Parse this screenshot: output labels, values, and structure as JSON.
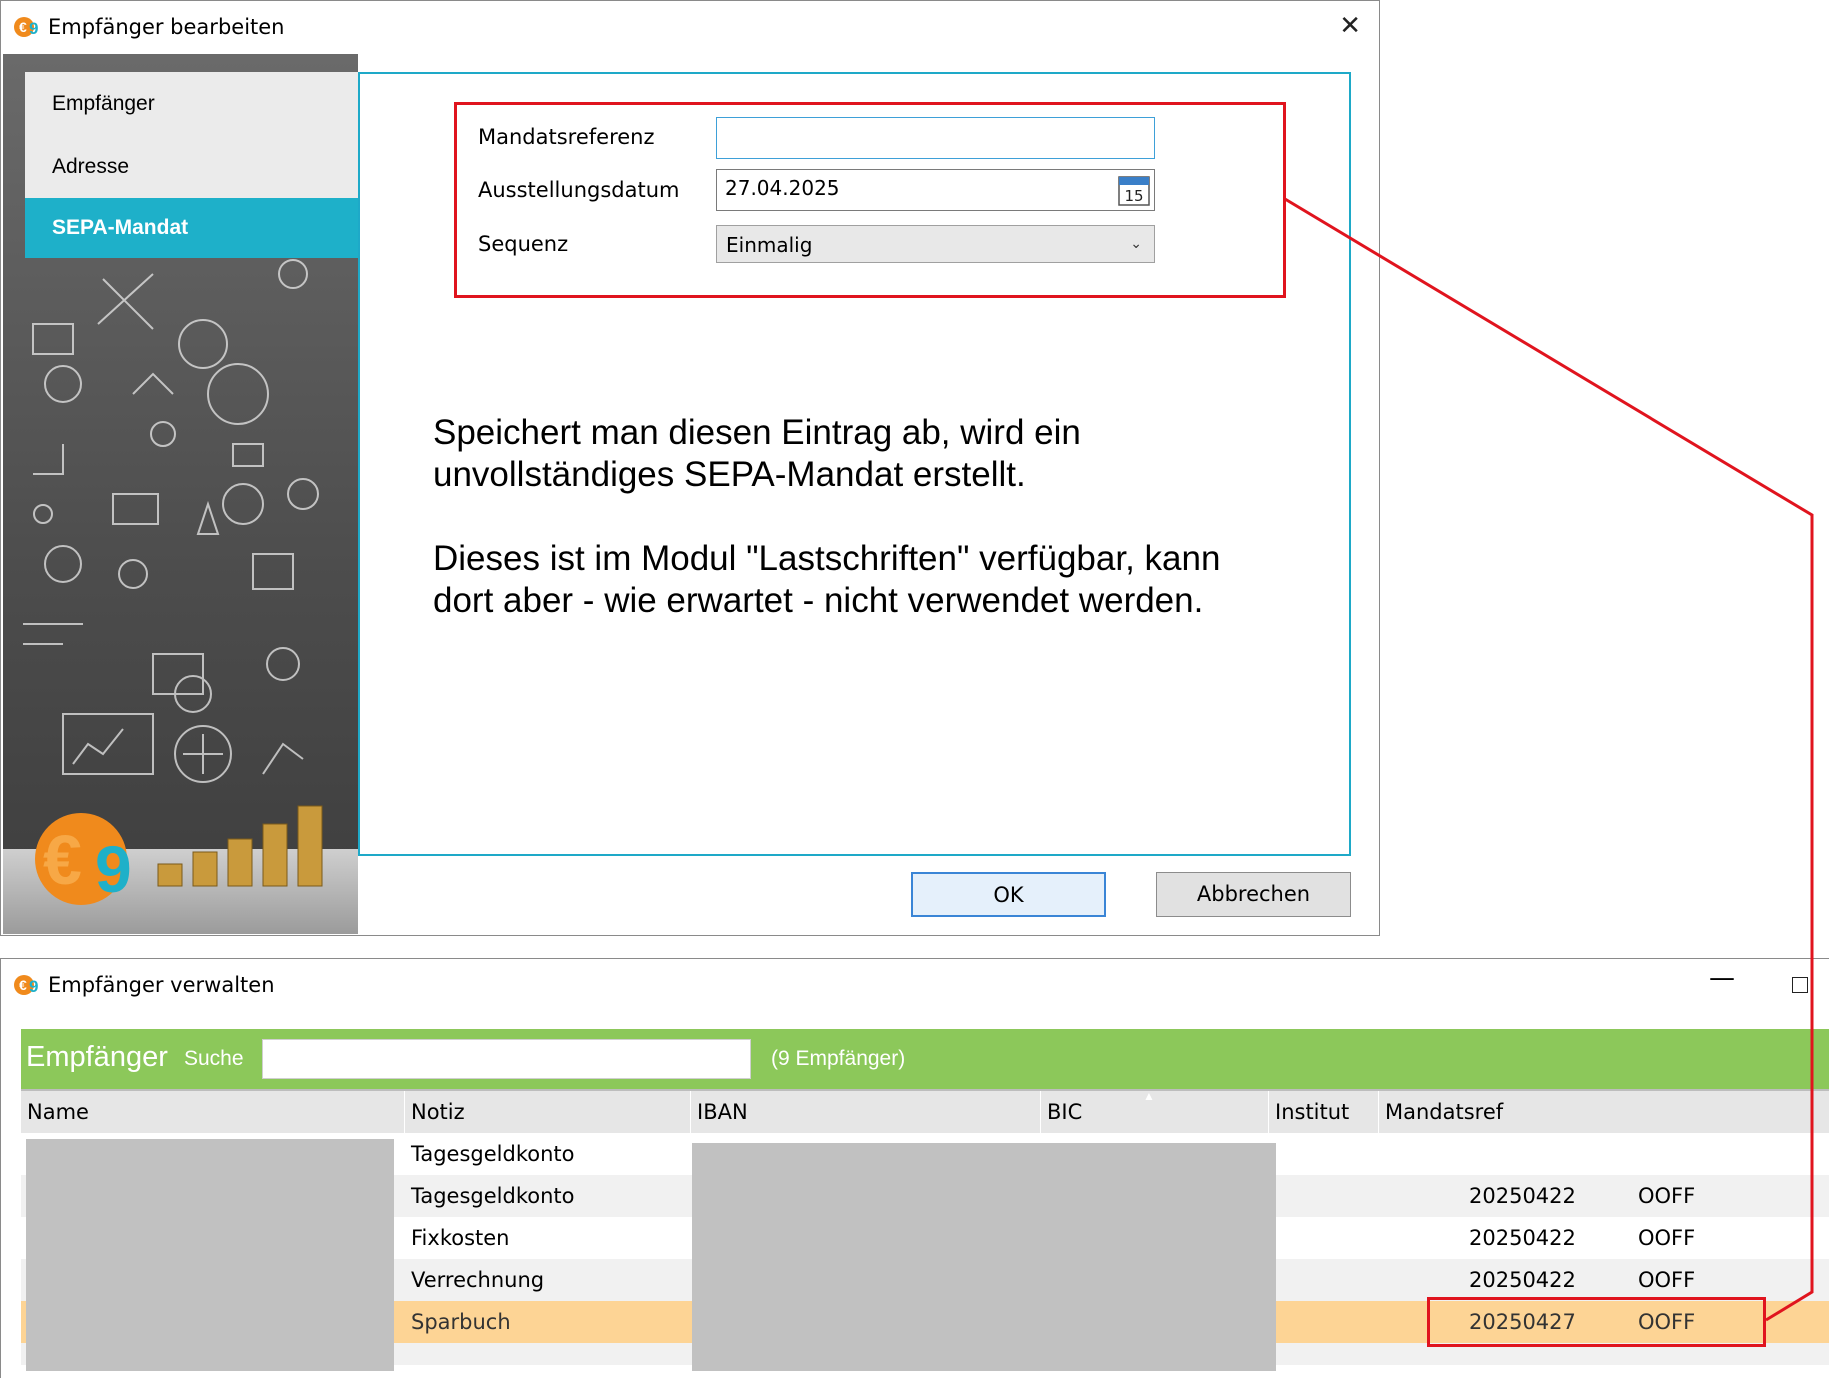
{
  "dialog": {
    "title": "Empfänger bearbeiten",
    "close_label": "✕",
    "nav": [
      {
        "label": "Empfänger"
      },
      {
        "label": "Adresse"
      },
      {
        "label": "SEPA-Mandat"
      }
    ],
    "form": {
      "mandatsreferenz_label": "Mandatsreferenz",
      "mandatsreferenz_value": "",
      "ausstellungsdatum_label": "Ausstellungsdatum",
      "ausstellungsdatum_value": "27.04.2025",
      "calendar_day": "15",
      "sequenz_label": "Sequenz",
      "sequenz_value": "Einmalig"
    },
    "annotation": {
      "line1": "Speichert man diesen Eintrag ab, wird ein",
      "line2": "unvollständiges SEPA-Mandat erstellt.",
      "line3": "Dieses ist im Modul \"Lastschriften\" verfügbar, kann",
      "line4": "dort aber - wie erwartet - nicht verwendet werden."
    },
    "buttons": {
      "ok": "OK",
      "cancel": "Abbrechen"
    }
  },
  "window": {
    "title": "Empfänger verwalten",
    "minimize_label": "—",
    "header": {
      "title": "Empfänger",
      "search_label": "Suche",
      "search_value": "",
      "count": "(9 Empfänger)"
    },
    "columns": [
      "Name",
      "Notiz",
      "IBAN",
      "BIC",
      "Institut",
      "Mandatsref"
    ],
    "rows": [
      {
        "notiz": "Tagesgeldkonto",
        "mandatsref": "",
        "sequenz": ""
      },
      {
        "notiz": "Tagesgeldkonto",
        "mandatsref": "20250422",
        "sequenz": "OOFF"
      },
      {
        "notiz": "Fixkosten",
        "mandatsref": "20250422",
        "sequenz": "OOFF"
      },
      {
        "notiz": "Verrechnung",
        "mandatsref": "20250422",
        "sequenz": "OOFF"
      },
      {
        "notiz": "Sparbuch",
        "mandatsref": "20250427",
        "sequenz": "OOFF"
      }
    ]
  },
  "colors": {
    "accent_teal": "#1eb0c9",
    "header_green": "#8cc85a",
    "highlight_red": "#e0141e",
    "selected_row": "#fdd495",
    "logo_orange": "#f08a1c"
  }
}
